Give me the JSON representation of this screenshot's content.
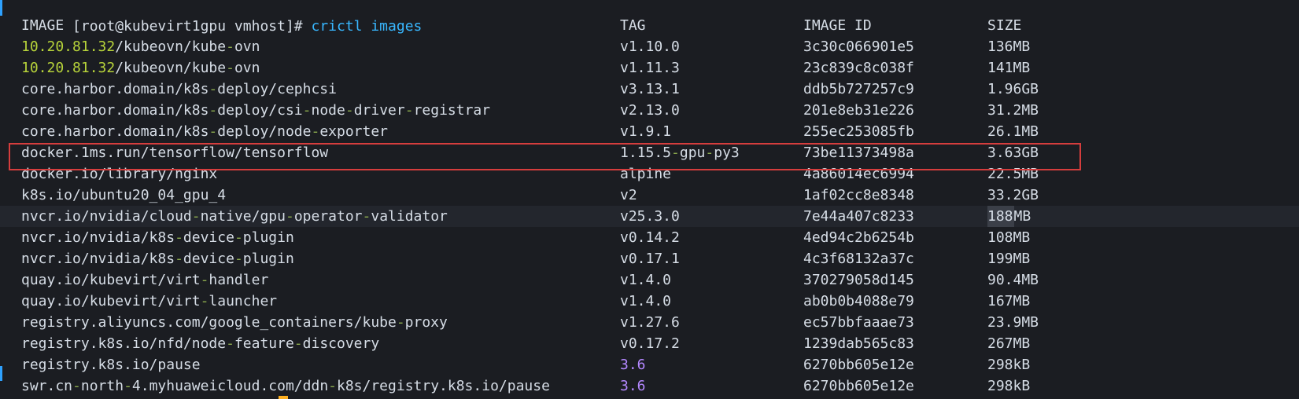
{
  "terminal": {
    "prompt": "[root@kubevirt1gpu vmhost]#",
    "command": "crictl images",
    "headers": [
      "IMAGE",
      "TAG",
      "IMAGE ID",
      "SIZE"
    ],
    "rows": [
      {
        "image": "10.20.81.32/kubeovn/kube-ovn",
        "tag": "v1.10.0",
        "image_id": "3c30c066901e5",
        "size": "136MB"
      },
      {
        "image": "10.20.81.32/kubeovn/kube-ovn",
        "tag": "v1.11.3",
        "image_id": "23c839c8c038f",
        "size": "141MB"
      },
      {
        "image": "core.harbor.domain/k8s-deploy/cephcsi",
        "tag": "v3.13.1",
        "image_id": "ddb5b727257c9",
        "size": "1.96GB"
      },
      {
        "image": "core.harbor.domain/k8s-deploy/csi-node-driver-registrar",
        "tag": "v2.13.0",
        "image_id": "201e8eb31e226",
        "size": "31.2MB"
      },
      {
        "image": "core.harbor.domain/k8s-deploy/node-exporter",
        "tag": "v1.9.1",
        "image_id": "255ec253085fb",
        "size": "26.1MB"
      },
      {
        "image": "docker.1ms.run/tensorflow/tensorflow",
        "tag": "1.15.5-gpu-py3",
        "image_id": "73be11373498a",
        "size": "3.63GB"
      },
      {
        "image": "docker.io/library/nginx",
        "tag": "alpine",
        "image_id": "4a86014ec6994",
        "size": "22.5MB"
      },
      {
        "image": "k8s.io/ubuntu20_04_gpu_4",
        "tag": "v2",
        "image_id": "1af02cc8e8348",
        "size": "33.2GB"
      },
      {
        "image": "nvcr.io/nvidia/cloud-native/gpu-operator-validator",
        "tag": "v25.3.0",
        "image_id": "7e44a407c8233",
        "size": "188MB"
      },
      {
        "image": "nvcr.io/nvidia/k8s-device-plugin",
        "tag": "v0.14.2",
        "image_id": "4ed94c2b6254b",
        "size": "108MB"
      },
      {
        "image": "nvcr.io/nvidia/k8s-device-plugin",
        "tag": "v0.17.1",
        "image_id": "4c3f68132a37c",
        "size": "199MB"
      },
      {
        "image": "quay.io/kubevirt/virt-handler",
        "tag": "v1.4.0",
        "image_id": "370279058d145",
        "size": "90.4MB"
      },
      {
        "image": "quay.io/kubevirt/virt-launcher",
        "tag": "v1.4.0",
        "image_id": "ab0b0b4088e79",
        "size": "167MB"
      },
      {
        "image": "registry.aliyuncs.com/google_containers/kube-proxy",
        "tag": "v1.27.6",
        "image_id": "ec57bbfaaae73",
        "size": "23.9MB"
      },
      {
        "image": "registry.k8s.io/nfd/node-feature-discovery",
        "tag": "v0.17.2",
        "image_id": "1239dab565c83",
        "size": "267MB"
      },
      {
        "image": "registry.k8s.io/pause",
        "tag": "3.6",
        "image_id": "6270bb605e12e",
        "size": "298kB"
      },
      {
        "image": "swr.cn-north-4.myhuaweicloud.com/ddn-k8s/registry.k8s.io/pause",
        "tag": "3.6",
        "image_id": "6270bb605e12e",
        "size": "298kB"
      }
    ]
  },
  "colors": {
    "background": "#1b1d22",
    "text": "#d6dde6",
    "command": "#38b7ff",
    "ip": "#b7d33a",
    "hyphen": "#8aa84d",
    "purple": "#b488ff",
    "highlight_box": "#d53d3d",
    "cursor": "#ffb020",
    "marker": "#2ea1ff"
  },
  "icons": [
    "terminal-cursor-icon"
  ]
}
